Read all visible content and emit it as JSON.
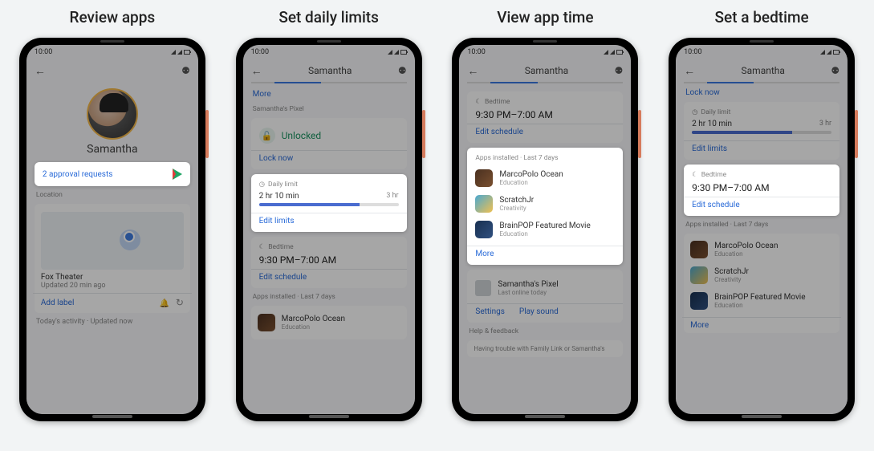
{
  "titles": [
    "Review apps",
    "Set daily limits",
    "View app time",
    "Set a bedtime"
  ],
  "status_time": "10:00",
  "child_name": "Samantha",
  "approval_text": "2 approval requests",
  "location_label": "Location",
  "place_name": "Fox Theater",
  "place_updated": "Updated 20 min ago",
  "add_label_text": "Add label",
  "today_footer": "Today's activity · Updated now",
  "more_link": "More",
  "device_label": "Samantha's Pixel",
  "unlocked_text": "Unlocked",
  "lock_now": "Lock now",
  "daily_limit_label": "Daily limit",
  "limit_value": "2 hr 10 min",
  "limit_max": "3 hr",
  "edit_limits": "Edit limits",
  "bedtime_label": "Bedtime",
  "bedtime_value": "9:30 PM–7:00 AM",
  "edit_schedule": "Edit schedule",
  "apps_label": "Apps installed · Last 7 days",
  "apps": [
    {
      "name": "MarcoPolo Ocean",
      "cat": "Education",
      "ico": "ico-marco"
    },
    {
      "name": "ScratchJr",
      "cat": "Creativity",
      "ico": "ico-scratch"
    },
    {
      "name": "BrainPOP Featured Movie",
      "cat": "Education",
      "ico": "ico-brainpop"
    }
  ],
  "last_online": "Last online today",
  "settings_link": "Settings",
  "play_sound_link": "Play sound",
  "help_label": "Help & feedback",
  "help_trouble": "Having trouble with Family Link or Samantha's"
}
